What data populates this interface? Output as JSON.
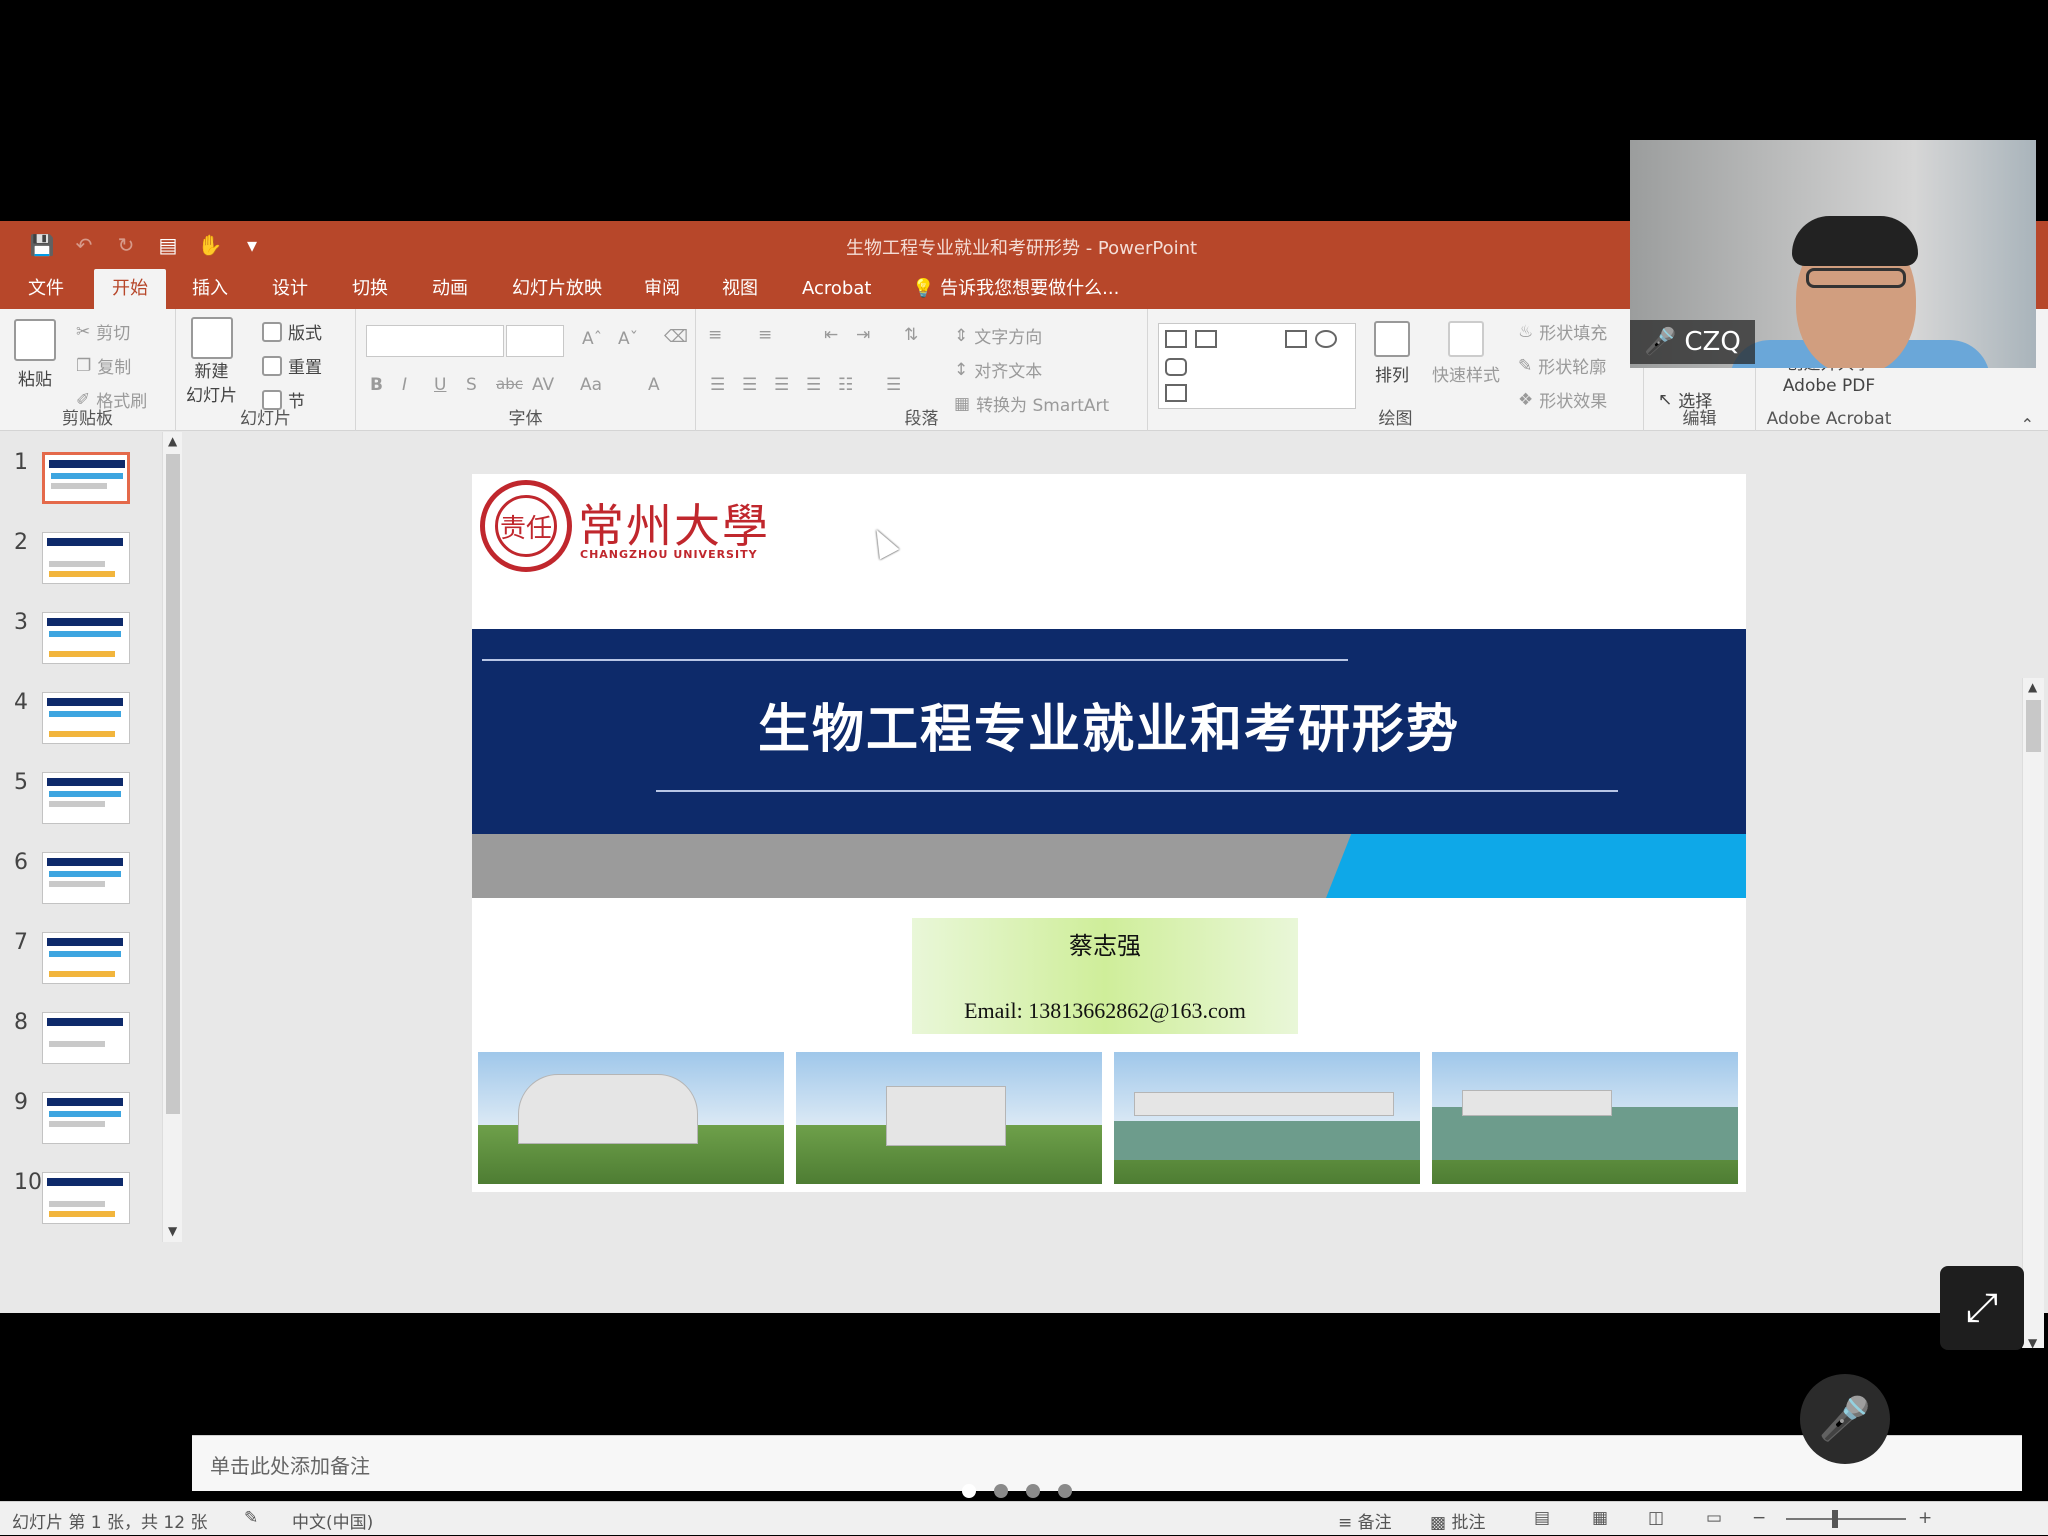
{
  "window": {
    "title": "生物工程专业就业和考研形势 - PowerPoint"
  },
  "tabs": [
    {
      "label": "文件"
    },
    {
      "label": "开始",
      "active": true
    },
    {
      "label": "插入"
    },
    {
      "label": "设计"
    },
    {
      "label": "切换"
    },
    {
      "label": "动画"
    },
    {
      "label": "幻灯片放映"
    },
    {
      "label": "审阅"
    },
    {
      "label": "视图"
    },
    {
      "label": "Acrobat"
    }
  ],
  "tell_me": "告诉我您想要做什么...",
  "ribbon": {
    "clipboard": {
      "label": "剪贴板",
      "paste": "粘贴",
      "cut": "剪切",
      "copy": "复制",
      "format_painter": "格式刷"
    },
    "slides": {
      "label": "幻灯片",
      "new_slide_1": "新建",
      "new_slide_2": "幻灯片",
      "layout": "版式",
      "reset": "重置",
      "section": "节"
    },
    "font": {
      "label": "字体",
      "bold": "B",
      "italic": "I",
      "underline": "U",
      "strike": "S",
      "shadow": "abc",
      "spacing": "AV",
      "case": "Aa",
      "color": "A"
    },
    "paragraph": {
      "label": "段落",
      "text_direction": "文字方向",
      "align_text": "对齐文本",
      "smartart": "转换为 SmartArt"
    },
    "drawing": {
      "label": "绘图",
      "arrange": "排列",
      "quick_styles": "快速样式",
      "shape_fill": "形状填充",
      "shape_outline": "形状轮廓",
      "shape_effects": "形状效果"
    },
    "editing": {
      "label": "编辑",
      "select": "选择"
    },
    "acrobat": {
      "label": "Adobe Acrobat",
      "create_1": "创建并共享",
      "create_2": "Adobe PDF"
    }
  },
  "thumbnails": [
    "1",
    "2",
    "3",
    "4",
    "5",
    "6",
    "7",
    "8",
    "9",
    "10"
  ],
  "slide": {
    "logo_name": "常州大學",
    "logo_sub": "CHANGZHOU UNIVERSITY",
    "logo_seal": "责任",
    "title": "生物工程专业就业和考研形势",
    "author": "蔡志强",
    "email": "Email: 13813662862@163.com"
  },
  "notes_placeholder": "单击此处添加备注",
  "status": {
    "slide_info": "幻灯片 第 1 张，共 12 张",
    "language": "中文(中国)",
    "notes": "备注",
    "comments": "批注"
  },
  "video": {
    "participant": "CZQ"
  },
  "pager": {
    "count": 4,
    "active": 0
  }
}
